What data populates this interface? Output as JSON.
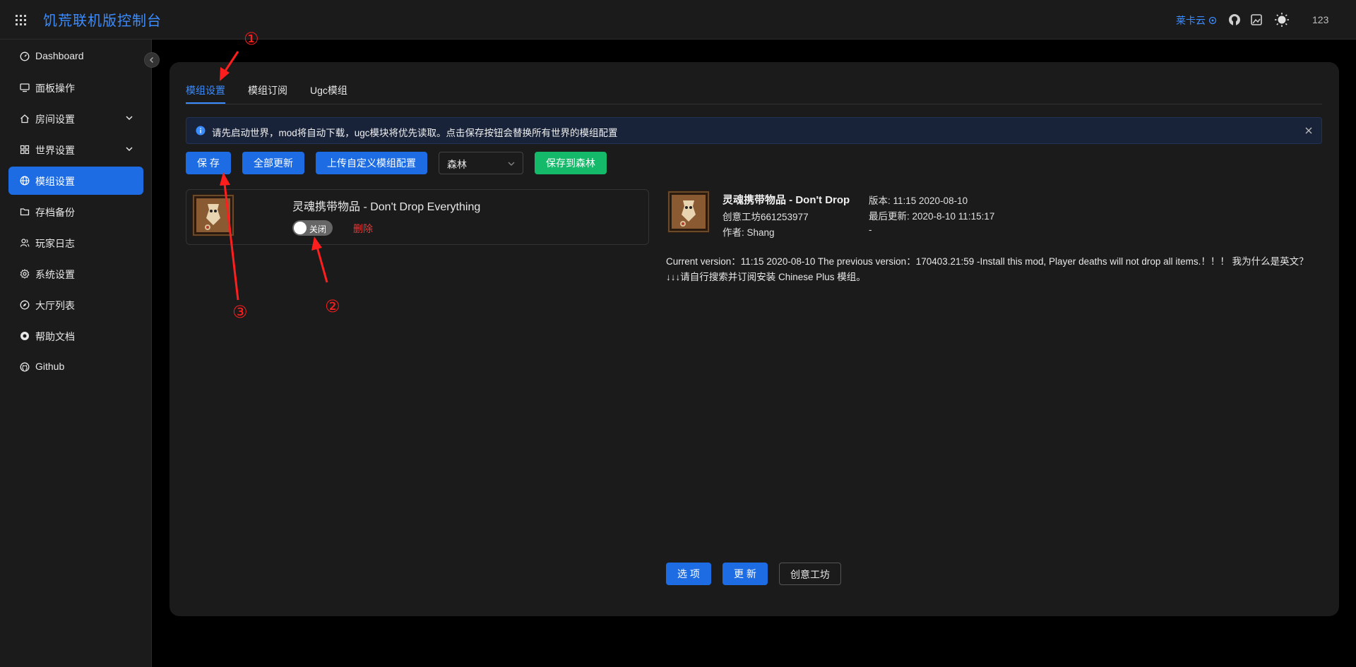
{
  "header": {
    "title": "饥荒联机版控制台",
    "link": "莱卡云",
    "user": "123",
    "icons": [
      "apps-grid-icon",
      "cloud-icon",
      "github-icon",
      "image-icon",
      "sun-icon"
    ]
  },
  "sidebar": {
    "items": [
      {
        "label": "Dashboard",
        "icon": "dashboard-icon"
      },
      {
        "label": "面板操作",
        "icon": "monitor-icon"
      },
      {
        "label": "房间设置",
        "icon": "home-icon",
        "has_children": true
      },
      {
        "label": "世界设置",
        "icon": "grid-icon",
        "has_children": true
      },
      {
        "label": "模组设置",
        "icon": "globe-icon",
        "active": true
      },
      {
        "label": "存档备份",
        "icon": "folder-icon"
      },
      {
        "label": "玩家日志",
        "icon": "users-icon"
      },
      {
        "label": "系统设置",
        "icon": "gear-icon"
      },
      {
        "label": "大厅列表",
        "icon": "compass-icon"
      },
      {
        "label": "帮助文档",
        "icon": "help-icon"
      },
      {
        "label": "Github",
        "icon": "github-icon"
      }
    ]
  },
  "tabs": [
    {
      "label": "模组设置",
      "active": true
    },
    {
      "label": "模组订阅"
    },
    {
      "label": "Ugc模组"
    }
  ],
  "alert": {
    "text": "请先启动世界，mod将自动下载，ugc模块将优先读取。点击保存按钮会替换所有世界的模组配置"
  },
  "toolbar": {
    "save": "保 存",
    "update_all": "全部更新",
    "upload_custom": "上传自定义模组配置",
    "world_select": "森林",
    "save_to": "保存到森林"
  },
  "mod": {
    "name": "灵魂携带物品 - Don't Drop Everything",
    "toggle_label": "关闭",
    "enabled": false,
    "delete": "删除"
  },
  "detail": {
    "title": "灵魂携带物品 - Don't Drop",
    "workshop": "创意工坊661253977",
    "author": "作者: Shang",
    "version": "版本: 11:15 2020-08-10",
    "last_update": "最后更新: 2020-8-10 11:15:17",
    "dash": "-",
    "description": "Current version：11:15 2020-08-10 The previous version：170403.21:59 -Install this mod, Player deaths will not drop all items.！！！ 我为什么是英文？↓↓↓请自行搜索并订阅安装 Chinese Plus 模组。"
  },
  "actions": {
    "options": "选 项",
    "update": "更 新",
    "workshop": "创意工坊"
  },
  "annotations": [
    "①",
    "②",
    "③"
  ],
  "colors": {
    "accent": "#1d6ce3",
    "link": "#3b8cff",
    "success": "#14b96a",
    "danger": "#e23b3b",
    "annotation": "#ff1e1e"
  }
}
